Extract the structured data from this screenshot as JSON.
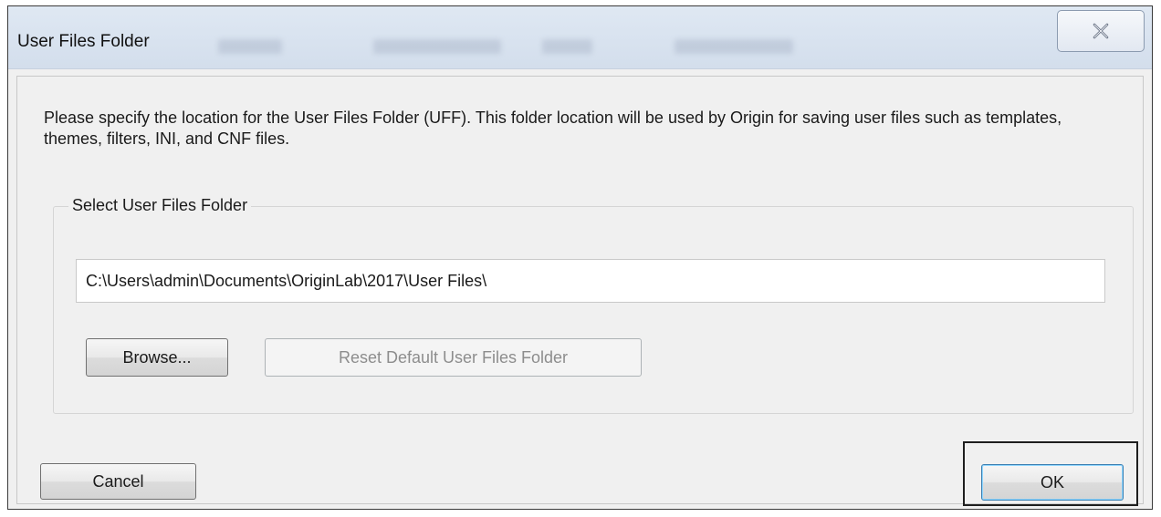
{
  "window": {
    "title": "User Files Folder"
  },
  "description": "Please specify the location for the User Files Folder (UFF). This folder location will be used by Origin for saving user files such as templates, themes, filters, INI, and CNF files.",
  "group": {
    "label": "Select User Files Folder",
    "path_value": "C:\\Users\\admin\\Documents\\OriginLab\\2017\\User Files\\"
  },
  "buttons": {
    "browse": "Browse...",
    "reset_default": "Reset Default User Files Folder",
    "cancel": "Cancel",
    "ok": "OK"
  },
  "icons": {
    "close": "close-icon"
  }
}
